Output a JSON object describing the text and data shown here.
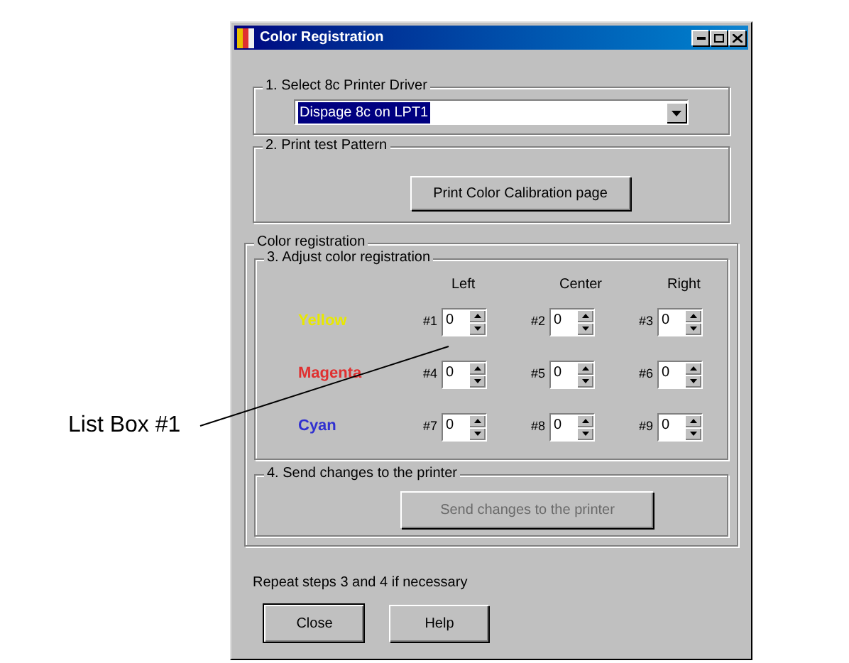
{
  "callout": {
    "label": "List Box #1"
  },
  "window": {
    "title": "Color Registration"
  },
  "driver_group": {
    "title": "1. Select 8c Printer Driver",
    "selected_driver": "Dispage 8c on LPT1"
  },
  "pattern_group": {
    "title": "2. Print test Pattern",
    "button": "Print Color Calibration page"
  },
  "registration": {
    "title": "Color registration",
    "adjust_group": {
      "title": "3. Adjust color registration",
      "columns": [
        "Left",
        "Center",
        "Right"
      ],
      "rows": [
        {
          "name": "Yellow",
          "color": "#e8e800",
          "spinners": [
            {
              "label": "#1",
              "value": "0"
            },
            {
              "label": "#2",
              "value": "0"
            },
            {
              "label": "#3",
              "value": "0"
            }
          ]
        },
        {
          "name": "Magenta",
          "color": "#e03030",
          "spinners": [
            {
              "label": "#4",
              "value": "0"
            },
            {
              "label": "#5",
              "value": "0"
            },
            {
              "label": "#6",
              "value": "0"
            }
          ]
        },
        {
          "name": "Cyan",
          "color": "#3030d0",
          "spinners": [
            {
              "label": "#7",
              "value": "0"
            },
            {
              "label": "#8",
              "value": "0"
            },
            {
              "label": "#9",
              "value": "0"
            }
          ]
        }
      ]
    },
    "send_group": {
      "title": "4. Send changes to the printer",
      "button": "Send changes to the printer",
      "disabled": true
    }
  },
  "note": "Repeat steps 3 and 4 if necessary",
  "buttons": [
    {
      "label": "Close",
      "default": true
    },
    {
      "label": "Help",
      "default": false
    }
  ]
}
